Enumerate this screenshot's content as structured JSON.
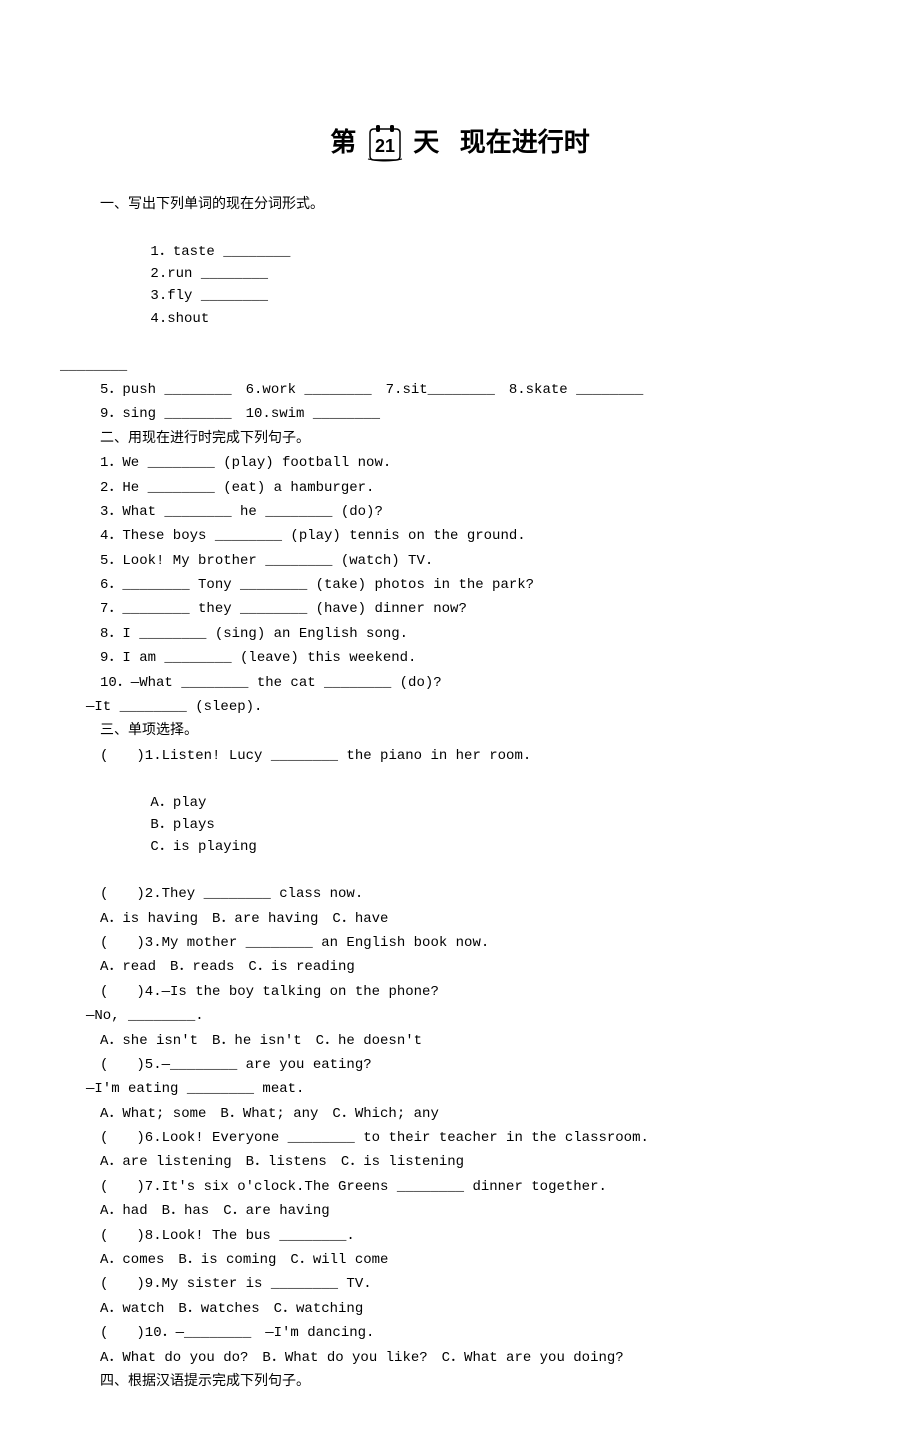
{
  "title": {
    "prefix": "第",
    "day_number": "21",
    "suffix": "天",
    "subtitle": "现在进行时"
  },
  "section1": {
    "heading": "一、写出下列单词的现在分词形式。",
    "row1": {
      "c1": "1．taste ________",
      "c2": "2.run ________",
      "c3": "3.fly ________",
      "c4": "4.shout"
    },
    "row1b": "________",
    "row2": "5．push ________　6.work ________　7.sit________　8.skate ________",
    "row3": "9．sing ________　10.swim ________"
  },
  "section2": {
    "heading": "二、用现在进行时完成下列句子。",
    "items": [
      "1．We ________ (play) football now.",
      "2．He ________ (eat) a hamburger.",
      "3．What ________ he ________ (do)?",
      "4．These boys ________ (play) tennis on the ground.",
      "5．Look! My brother ________ (watch) TV.",
      "6．________ Tony ________ (take) photos in the park?",
      "7．________ they ________ (have) dinner now?",
      "8．I ________ (sing) an English song.",
      "9．I am ________ (leave) this weekend.",
      "10．—What ________ the cat ________ (do)?"
    ],
    "tail": "—It ________ (sleep)."
  },
  "section3": {
    "heading": "三、单项选择。",
    "q1_stem": "(　　)1.Listen! Lucy ________ the piano in her room.",
    "q1_opts": {
      "a": "A．play",
      "b": "B．plays",
      "c": "C．is playing"
    },
    "q2_stem": "(　　)2.They ________ class now.",
    "q2_opts": "A．is having　B．are having　C．have",
    "q3_stem": "(　　)3.My mother ________ an English book now.",
    "q3_opts": "A．read　B．reads　C．is reading",
    "q4_stem": "(　　)4.—Is the boy talking on the phone?",
    "q4_tail": "—No, ________.",
    "q4_opts": "A．she isn't　B．he isn't　C．he doesn't",
    "q5_stem": "(　　)5.—________ are you eating?",
    "q5_tail": "—I'm eating ________ meat.",
    "q5_opts": "A．What; some　B．What; any　C．Which; any",
    "q6_stem": "(　　)6.Look! Everyone ________ to their teacher in the classroom.",
    "q6_opts": "A．are listening　B．listens　C．is listening",
    "q7_stem": "(　　)7.It's six o'clock.The Greens ________ dinner together.",
    "q7_opts": "A．had　B．has　C．are having",
    "q8_stem": "(　　)8.Look! The bus ________.",
    "q8_opts": "A．comes　B．is coming　C．will come",
    "q9_stem": "(　　)9.My sister is ________ TV.",
    "q9_opts": "A．watch　B．watches　C．watching",
    "q10_stem": "(　　)10．—________　—I'm dancing.",
    "q10_opts": "A．What do you do?　B．What do you like?　C．What are you doing?"
  },
  "section4": {
    "heading": "四、根据汉语提示完成下列句子。"
  }
}
